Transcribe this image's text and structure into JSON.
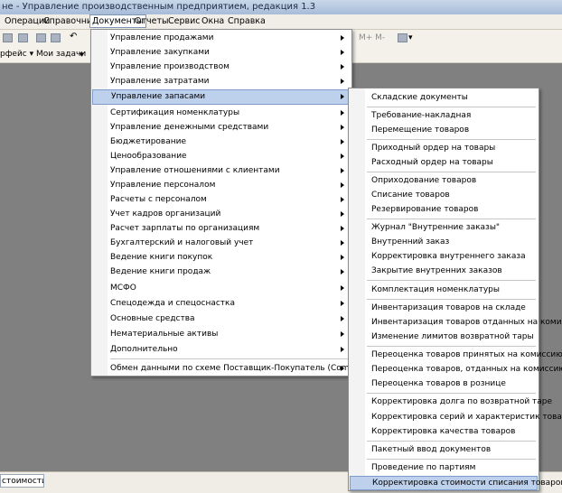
{
  "window": {
    "title": "не - Управление производственным предприятием, редакция 1.3"
  },
  "menubar": {
    "items": [
      "Операции",
      "Справочники",
      "Документы",
      "Отчеты",
      "Сервис",
      "Окна",
      "Справка"
    ],
    "active": "Документы"
  },
  "toolbar": {
    "memory_buttons": "M+ M-",
    "panel_label": "рфейс ▾",
    "tasks_label": "Мои задачи"
  },
  "documents_menu": {
    "items": [
      "Управление продажами",
      "Управление закупками",
      "Управление производством",
      "Управление затратами",
      "Управление запасами",
      "Сертификация номенклатуры",
      "Управление денежными средствами",
      "Бюджетирование",
      "Ценообразование",
      "Управление отношениями с клиентами",
      "Управление персоналом",
      "Расчеты с персоналом",
      "Учет кадров организаций",
      "Расчет зарплаты по организациям",
      "Бухгалтерский и налоговый учет",
      "Ведение книги покупок",
      "Ведение книги продаж",
      "МСФО",
      "Спецодежда и спецоснастка",
      "Основные средства",
      "Нематериальные активы",
      "Дополнительно",
      "Обмен данными по схеме Поставщик-Покупатель (CommerceML)"
    ],
    "highlighted": "Управление запасами"
  },
  "inventory_submenu": {
    "items": [
      "Складские документы",
      "Требование-накладная",
      "Перемещение товаров",
      "Приходный ордер на товары",
      "Расходный ордер на товары",
      "Оприходование товаров",
      "Списание товаров",
      "Резервирование товаров",
      "Журнал \"Внутренние заказы\"",
      "Внутренний заказ",
      "Корректировка внутреннего заказа",
      "Закрытие внутренних заказов",
      "Комплектация номенклатуры",
      "Инвентаризация товаров на складе",
      "Инвентаризация товаров отданных на комиссию",
      "Изменение лимитов возвратной тары",
      "Переоценка товаров принятых на комиссию",
      "Переоценка товаров, отданных на комиссию",
      "Переоценка товаров в рознице",
      "Корректировка долга по возвратной таре",
      "Корректировка серий и характеристик товаров",
      "Корректировка качества товаров",
      "Пакетный ввод документов",
      "Проведение по партиям",
      "Корректировка стоимости списания товаров"
    ],
    "highlighted": "Корректировка стоимости списания товаров"
  },
  "taskbar": {
    "tab_label": "стоимости ..."
  }
}
